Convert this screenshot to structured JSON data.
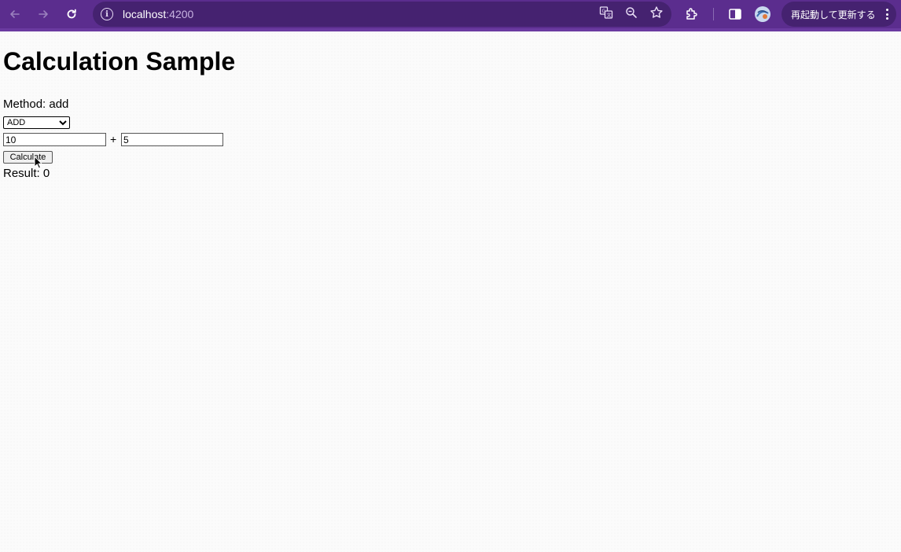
{
  "browser": {
    "url_host": "localhost",
    "url_port": ":4200",
    "restart_label": "再起動して更新する",
    "icons": [
      "back-arrow-icon",
      "forward-arrow-icon",
      "reload-icon",
      "info-icon",
      "translate-icon",
      "zoom-icon",
      "star-icon",
      "extensions-icon",
      "sidebar-icon",
      "profile-icon",
      "kebab-menu-icon"
    ]
  },
  "page": {
    "title": "Calculation Sample",
    "method_label": "Method: add",
    "select_value": "ADD",
    "select_options": [
      "ADD"
    ],
    "input1_value": "10",
    "operator": "+",
    "input2_value": "5",
    "calculate_label": "Calculate",
    "result_label": "Result: 0"
  },
  "colors": {
    "toolbar": "#5b2d8e",
    "omnibox": "#452270"
  }
}
